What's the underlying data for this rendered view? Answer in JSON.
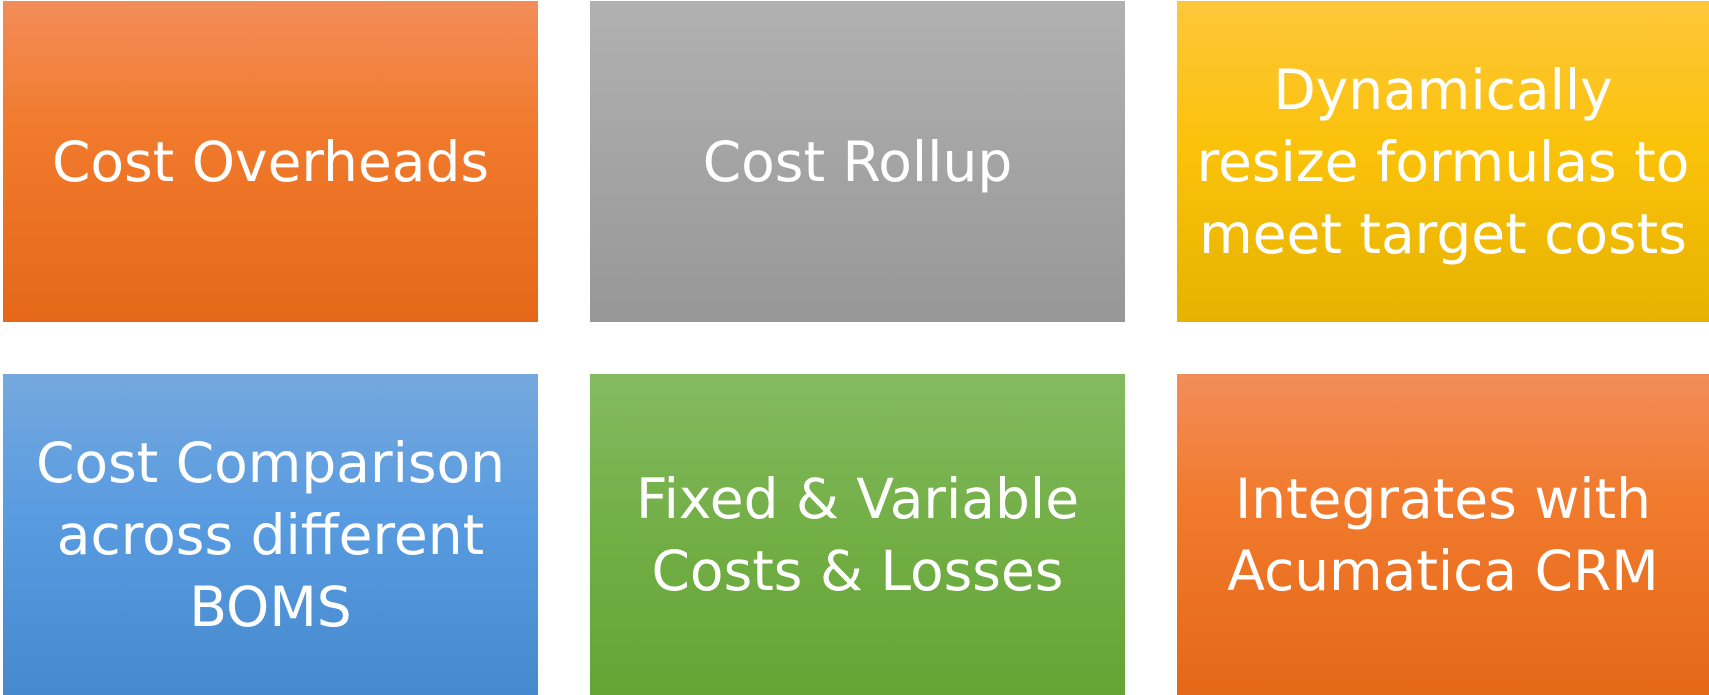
{
  "tiles": [
    {
      "lines": [
        "Cost Overheads"
      ]
    },
    {
      "lines": [
        "Cost Rollup"
      ]
    },
    {
      "lines": [
        "Dynamically",
        "resize formulas to",
        "meet target costs"
      ]
    },
    {
      "lines": [
        "Cost Comparison",
        "across different",
        "BOMS"
      ]
    },
    {
      "lines": [
        "Fixed & Variable",
        "Costs & Losses"
      ]
    },
    {
      "lines": [
        "Integrates with",
        "Acumatica CRM"
      ]
    }
  ],
  "colors": {
    "orange": "#f17a2c",
    "gray": "#a4a4a4",
    "gold": "#fbc20a",
    "blue": "#589be0",
    "green": "#72ae45",
    "text": "#ffffff"
  }
}
